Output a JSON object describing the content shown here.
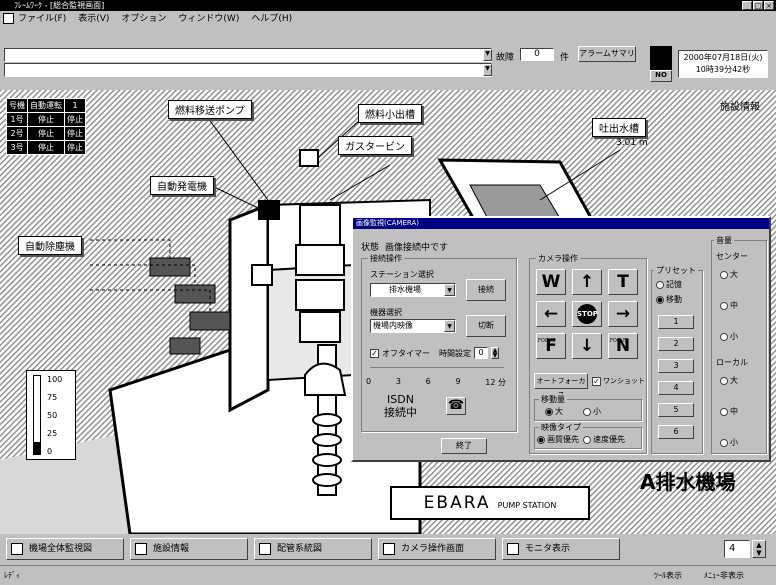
{
  "window": {
    "title": "ﾌﾚｰﾑﾜｰｸ - [総合監視画面]"
  },
  "menu": [
    "ファイル(F)",
    "表示(V)",
    "オプション",
    "ウィンドウ(W)",
    "ヘルプ(H)"
  ],
  "toolbar": {
    "fault_label": "故障",
    "fault_count": "0",
    "fault_unit": "件",
    "alarm_button": "アラームサマリ",
    "no_badge": "NO",
    "datetime_line1": "2000年07月18日(火)",
    "datetime_line2": "10時39分42秒"
  },
  "status_table": {
    "rows": [
      [
        "号機",
        "自動運転",
        "1"
      ],
      [
        "1号",
        "停止",
        "停止"
      ],
      [
        "2号",
        "停止",
        "停止"
      ],
      [
        "3号",
        "停止",
        "停止"
      ]
    ]
  },
  "scene": {
    "labels": {
      "fuel_pump": "燃料移送ポンプ",
      "fuel_tank": "燃料小出槽",
      "gas_turbine": "ガスタービン",
      "generator": "自動発電機",
      "screen": "自動除塵機",
      "outlet": "吐出水槽",
      "outlet_value": "3.01 m",
      "facility_info": "施設情報",
      "station_name": "A排水機場",
      "brand": "EBARA",
      "brand_sub": "PUMP STATION"
    },
    "gauge": {
      "ticks": [
        "100",
        "75",
        "50",
        "25",
        "0"
      ],
      "level_percent": 15
    }
  },
  "dialog": {
    "title": "画像監視(CAMERA)",
    "state_label": "状態",
    "state_value": "画像接続中です",
    "connect_group": "接続操作",
    "station_select_label": "ステーション選択",
    "station_value": "排水機場",
    "connect_button": "接続",
    "device_select_label": "機器選択",
    "device_value": "機場内映像",
    "disconnect_button": "切断",
    "offtimer_label": "オフタイマー",
    "time_setting_label": "時間設定",
    "time_value": "0",
    "scale_labels": [
      "0",
      "3",
      "6",
      "9",
      "12 分"
    ],
    "isdn_line1": "ISDN",
    "isdn_line2": "接続中",
    "end_button": "終了",
    "camera_group": "カメラ操作",
    "cam_buttons": [
      "W",
      "↑",
      "T",
      "←",
      "STOP",
      "→",
      "F",
      "↓",
      "N"
    ],
    "focus_small": "FOCUS",
    "autofocus_button": "オートフォーカス",
    "oneshot_label": "ワンショット",
    "move_group": "移動量",
    "move_options": [
      "大",
      "小"
    ],
    "video_group": "映像タイプ",
    "video_options": [
      "画質優先",
      "速度優先"
    ],
    "preset_group": "プリセット",
    "preset_options": [
      "記憶",
      "移動"
    ],
    "preset_numbers": [
      "1",
      "2",
      "3",
      "4",
      "5",
      "6"
    ],
    "volume_group": "音量",
    "center_label": "センター",
    "volume_options": [
      "大",
      "中",
      "小"
    ],
    "local_label": "ローカル"
  },
  "taskbar": {
    "buttons": [
      "機場全体監視図",
      "施設情報",
      "配管系統図",
      "カメラ操作画面",
      "モニタ表示"
    ],
    "page_value": "4"
  },
  "status": {
    "left": "ﾚﾃﾞｨ",
    "right1": "ﾂｰﾙ表示",
    "right2": "ﾒﾆｭｰ非表示"
  },
  "colors": {
    "accent": "#000080",
    "background": "#c0c0c0"
  }
}
